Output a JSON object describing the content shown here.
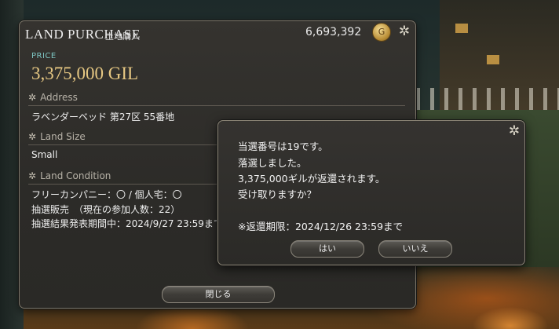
{
  "window": {
    "title_en": "LAND PURCHASE",
    "title_jp": "土地購入",
    "gil_total": "6,693,392",
    "coin_icon": "gil-coin-icon",
    "gear_icon": "config-gear-icon"
  },
  "price": {
    "label": "PRICE",
    "value": "3,375,000 GIL"
  },
  "address": {
    "heading": "Address",
    "value": "ラベンダーベッド 第27区 55番地"
  },
  "land_size": {
    "heading": "Land Size",
    "value": "Small"
  },
  "land_condition": {
    "heading": "Land Condition",
    "line1": "フリーカンパニー：〇 / 個人宅：〇",
    "line2": "抽選販売　（現在の参加人数：22）",
    "line3": "抽選結果発表期間中：2024/9/27 23:59まで"
  },
  "close_button": "閉じる",
  "dialog": {
    "line1": "当選番号は19です。",
    "line2": "落選しました。",
    "line3": "3,375,000ギルが返還されます。",
    "line4": "受け取りますか？",
    "line5": "※返還期限：2024/12/26 23:59まで",
    "yes_label": "はい",
    "no_label": "いいえ"
  },
  "colors": {
    "price_label": "#7ec7c4",
    "price_value": "#e7c883",
    "panel_bg": "#2c2b28",
    "panel_border": "#7a7468"
  }
}
